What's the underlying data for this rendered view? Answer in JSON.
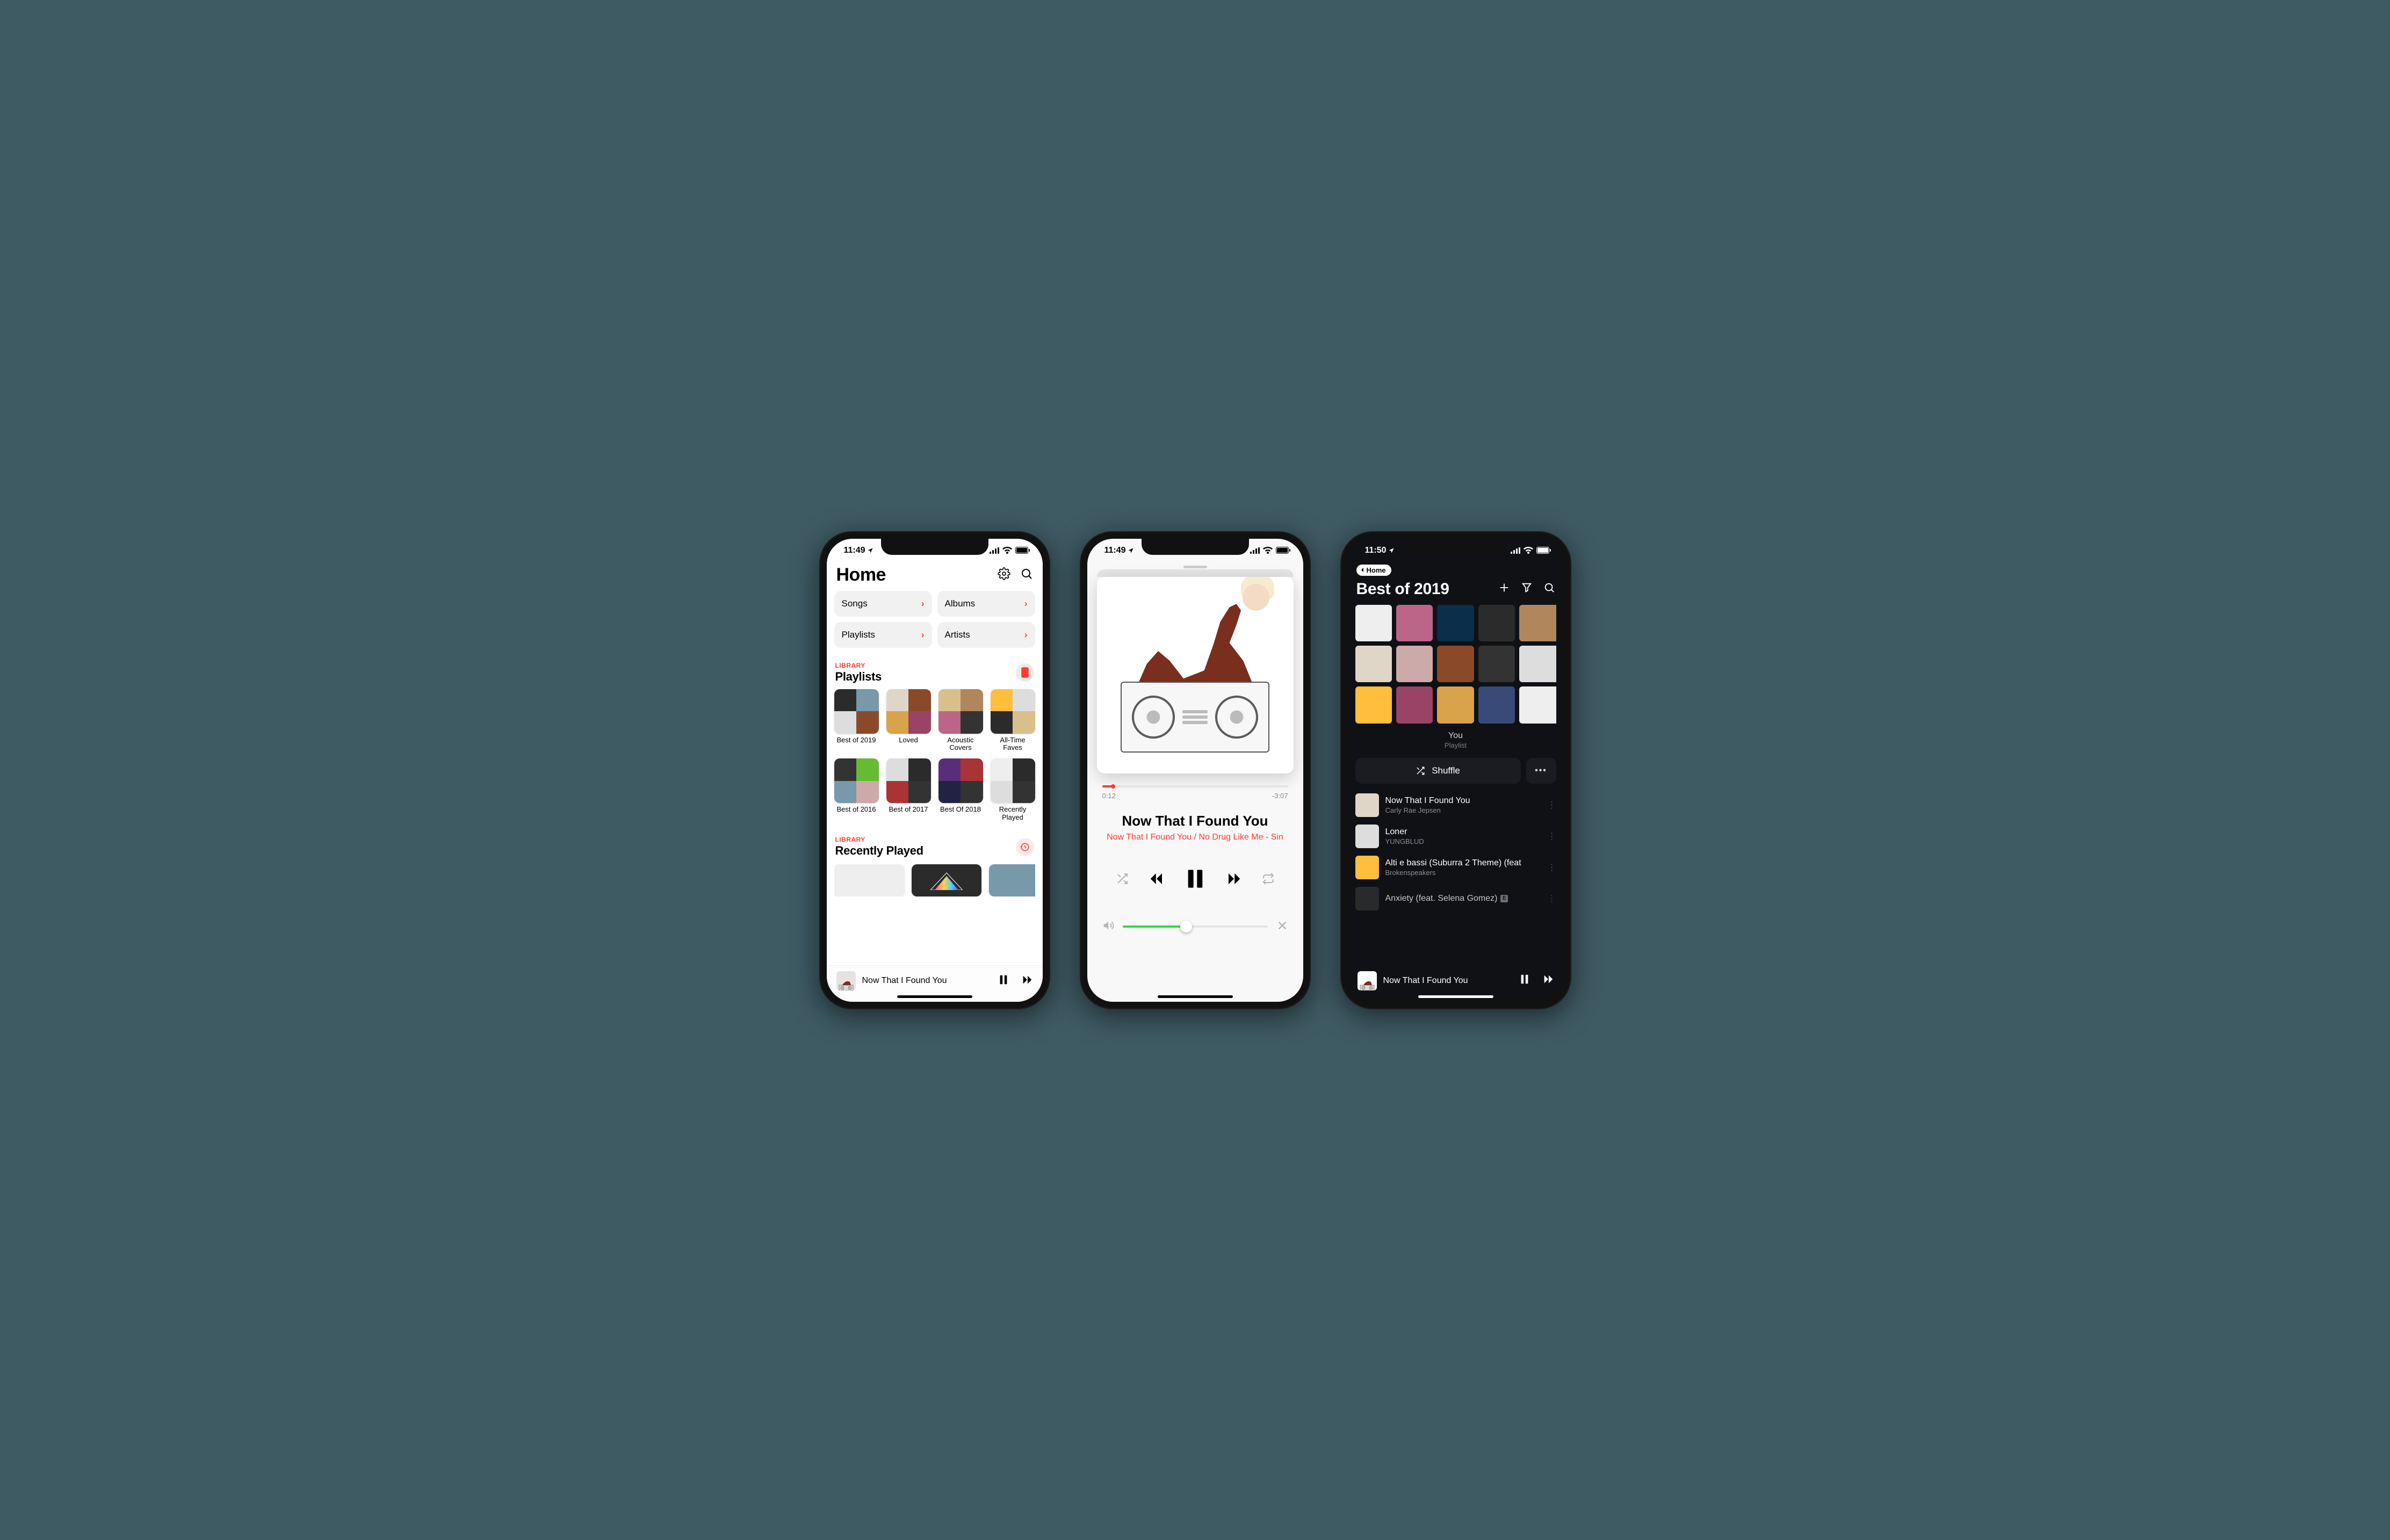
{
  "screen1": {
    "status_time": "11:49",
    "title": "Home",
    "categories": [
      "Songs",
      "Albums",
      "Playlists",
      "Artists"
    ],
    "section1_eyebrow": "LIBRARY",
    "section1_title": "Playlists",
    "playlists": [
      "Best of 2019",
      "Loved",
      "Acoustic Covers",
      "All-Time Faves",
      "Best of 2016",
      "Best of 2017",
      "Best Of 2018",
      "Recently Played"
    ],
    "section2_eyebrow": "LIBRARY",
    "section2_title": "Recently Played",
    "now_playing": "Now That I Found You"
  },
  "screen2": {
    "status_time": "11:49",
    "elapsed": "0:12",
    "remaining": "-3:07",
    "progress_pct": 6,
    "track_title": "Now That I Found You",
    "subtitle": "Now That I Found You / No Drug Like Me - Sin",
    "volume_pct": 44
  },
  "screen3": {
    "status_time": "11:50",
    "back_label": "Home",
    "title": "Best of 2019",
    "meta_title": "You",
    "meta_sub": "Playlist",
    "shuffle_label": "Shuffle",
    "more_label": "•••",
    "tracks": [
      {
        "title": "Now That I Found You",
        "artist": "Carly Rae Jepsen",
        "explicit": false
      },
      {
        "title": "Loner",
        "artist": "YUNGBLUD",
        "explicit": false
      },
      {
        "title": "Alti e bassi (Suburra 2 Theme) (feat",
        "artist": "Brokenspeakers",
        "explicit": false
      },
      {
        "title": "Anxiety (feat. Selena Gomez)",
        "artist": "",
        "explicit": true
      }
    ],
    "now_playing": "Now That I Found You",
    "explicit_badge": "E"
  }
}
